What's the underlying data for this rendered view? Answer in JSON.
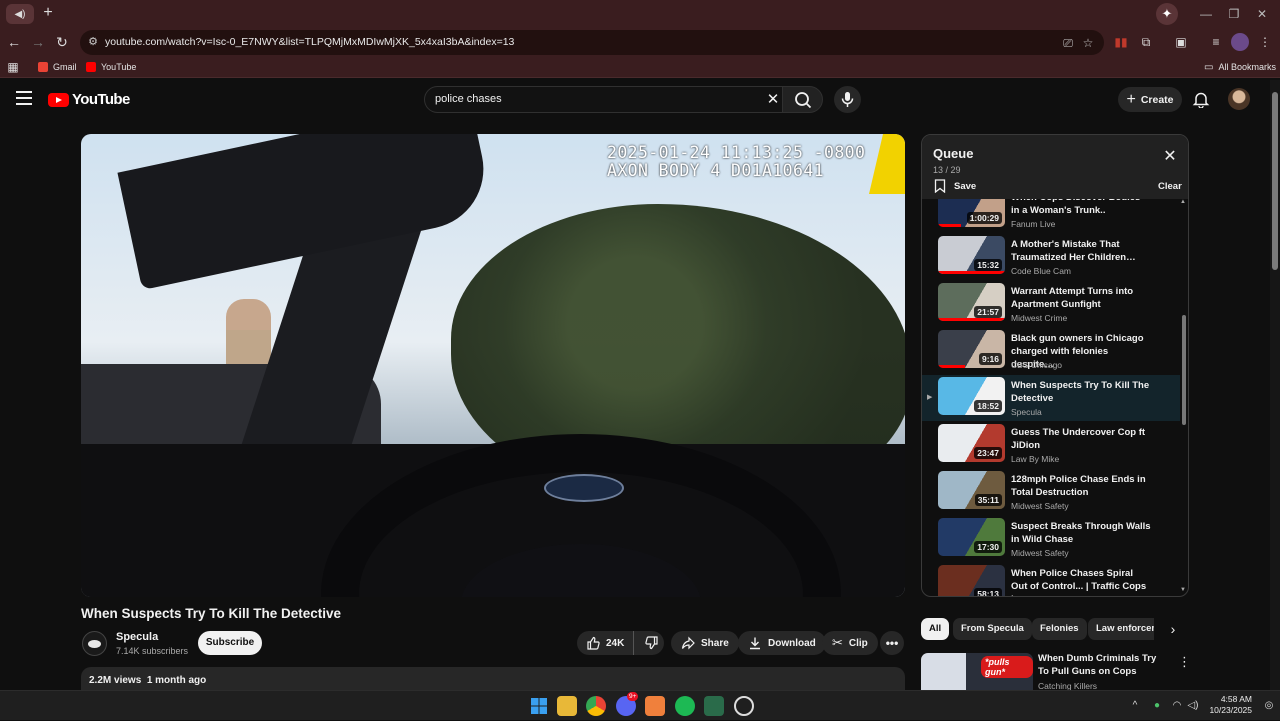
{
  "browser": {
    "url": "youtube.com/watch?v=Isc-0_E7NWY&list=TLPQMjMxMDIwMjXK_5x4xaI3bA&index=13",
    "bookmarks": [
      {
        "label": "Gmail",
        "color": "#ea4335"
      },
      {
        "label": "YouTube",
        "color": "#ff0000"
      }
    ],
    "all_bookmarks_label": "All Bookmarks"
  },
  "header": {
    "logo_text": "YouTube",
    "search_value": "police chases",
    "create_label": "Create"
  },
  "player": {
    "overlay_line1": "2025-01-24 11:13:25 -0800",
    "overlay_line2": "AXON BODY 4 D01A10641"
  },
  "video": {
    "title": "When Suspects Try To Kill The Detective",
    "channel": "Specula",
    "subscribers": "7.14K subscribers",
    "subscribe_label": "Subscribe",
    "likes": "24K",
    "share_label": "Share",
    "download_label": "Download",
    "clip_label": "Clip",
    "views": "2.2M views",
    "age": "1 month ago"
  },
  "queue": {
    "title": "Queue",
    "position": "13 / 29",
    "save_label": "Save",
    "clear_label": "Clear",
    "items": [
      {
        "title": "When Cops Discover Bodies in a Woman's Trunk..",
        "channel": "Fanum Live",
        "duration": "1:00:29",
        "progress": 0.35,
        "colors": [
          "#1c2d52",
          "#c2a089"
        ]
      },
      {
        "title": "A Mother's Mistake That Traumatized Her Children…",
        "channel": "Code Blue Cam",
        "duration": "15:32",
        "progress": 1.0,
        "colors": [
          "#c9ccd3",
          "#3b4a63"
        ]
      },
      {
        "title": "Warrant Attempt Turns into Apartment Gunfight",
        "channel": "Midwest Crime",
        "duration": "21:57",
        "progress": 1.0,
        "colors": [
          "#5d6d5c",
          "#d6cfc4"
        ]
      },
      {
        "title": "Black gun owners in Chicago charged with felonies despite…",
        "channel": "CBS Chicago",
        "duration": "9:16",
        "progress": 0.4,
        "colors": [
          "#3a3f4a",
          "#c9b6a6"
        ]
      },
      {
        "title": "When Suspects Try To Kill The Detective",
        "channel": "Specula",
        "duration": "18:52",
        "progress": 0.0,
        "colors": [
          "#58b8e6",
          "#f2f2f2"
        ]
      },
      {
        "title": "Guess The Undercover Cop ft JiDion",
        "channel": "Law By Mike",
        "duration": "23:47",
        "progress": 0.0,
        "colors": [
          "#e9ecef",
          "#b33a2e"
        ]
      },
      {
        "title": "128mph Police Chase Ends in Total Destruction",
        "channel": "Midwest Safety",
        "duration": "35:11",
        "progress": 0.0,
        "colors": [
          "#9fb7c7",
          "#6e5b3f"
        ]
      },
      {
        "title": "Suspect Breaks Through Walls in Wild Chase",
        "channel": "Midwest Safety",
        "duration": "17:30",
        "progress": 0.0,
        "colors": [
          "#223a66",
          "#4f7a3c"
        ]
      },
      {
        "title": "When Police Chases Spiral Out of Control... | Traffic Cops |…",
        "channel": "Blue Light: Emergency Resp…",
        "duration": "58:13",
        "progress": 0.0,
        "colors": [
          "#6b2e1f",
          "#2b3141"
        ]
      }
    ]
  },
  "chips": [
    "All",
    "From Specula",
    "Felonies",
    "Law enforcem"
  ],
  "recommendation": {
    "title": "When Dumb Criminals Try To Pull Guns on Cops",
    "channel": "Catching Killers",
    "thumb_tag": "*pulls gun*"
  },
  "taskbar": {
    "time": "4:58 AM",
    "date": "10/23/2025",
    "discord_badge": "9+"
  }
}
